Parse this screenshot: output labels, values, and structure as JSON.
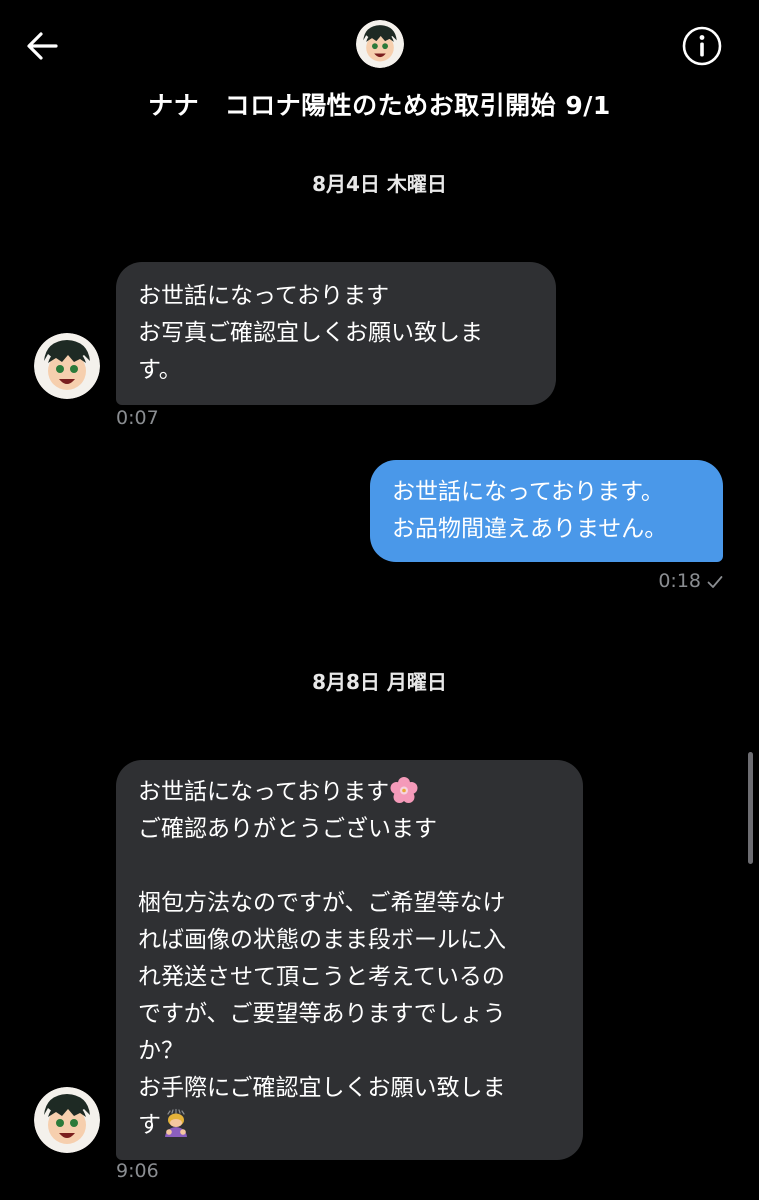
{
  "header": {
    "back_icon": "arrow-left-icon",
    "info_icon": "info-icon",
    "avatar_icon": "anime-boy-avatar",
    "title": "ナナ　コロナ陽性のためお取引開始 9/1"
  },
  "conversation": {
    "date_1": "8月4日 木曜日",
    "msg_1": {
      "lines": [
        "お世話になっております",
        "お写真ご確認宜しくお願い致しま",
        "す。"
      ],
      "time": "0:07"
    },
    "msg_2": {
      "lines": [
        "お世話になっております。",
        "お品物間違えありません。"
      ],
      "time": "0:18",
      "status_icon": "check-icon"
    },
    "date_2": "8月8日 月曜日",
    "msg_3": {
      "lines": [
        "お世話になっております",
        "ご確認ありがとうございます",
        "",
        "梱包方法なのですが、ご希望等なけ",
        "れば画像の状態のまま段ボールに入",
        "れ発送させて頂こうと考えているの",
        "ですが、ご要望等ありますでしょう",
        "か？",
        "お手際にご確認宜しくお願い致しま",
        "す"
      ],
      "emoji_1": "cherry-blossom-emoji",
      "emoji_2": "bowing-person-emoji",
      "time": "9:06"
    }
  },
  "colors": {
    "background": "#000000",
    "received_bubble": "#2f3033",
    "sent_bubble": "#4a98e9",
    "timestamp": "#8a8d91"
  }
}
